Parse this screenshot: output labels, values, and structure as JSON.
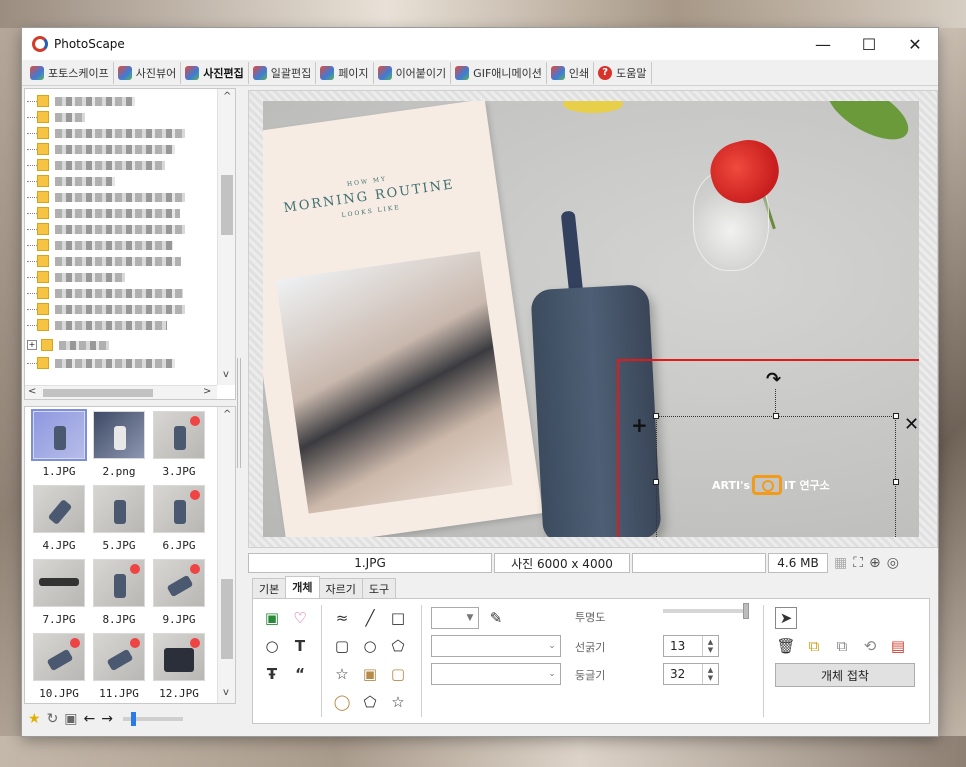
{
  "window": {
    "title": "PhotoScape",
    "controls": [
      "—",
      "☐",
      "✕"
    ]
  },
  "menu_tabs": [
    {
      "label": "포토스케이프",
      "active": false
    },
    {
      "label": "사진뷰어",
      "active": false
    },
    {
      "label": "사진편집",
      "active": true
    },
    {
      "label": "일괄편집",
      "active": false
    },
    {
      "label": "페이지",
      "active": false
    },
    {
      "label": "이어붙이기",
      "active": false
    },
    {
      "label": "GIF애니메이션",
      "active": false
    },
    {
      "label": "인쇄",
      "active": false
    },
    {
      "label": "도움말",
      "active": false
    }
  ],
  "thumbnails": [
    {
      "name": "1.JPG",
      "selected": true
    },
    {
      "name": "2.png",
      "selected": false
    },
    {
      "name": "3.JPG",
      "selected": false
    },
    {
      "name": "4.JPG",
      "selected": false
    },
    {
      "name": "5.JPG",
      "selected": false
    },
    {
      "name": "6.JPG",
      "selected": false
    },
    {
      "name": "7.JPG",
      "selected": false
    },
    {
      "name": "8.JPG",
      "selected": false
    },
    {
      "name": "9.JPG",
      "selected": false
    },
    {
      "name": "10.JPG",
      "selected": false
    },
    {
      "name": "11.JPG",
      "selected": false
    },
    {
      "name": "12.JPG",
      "selected": false
    }
  ],
  "photo": {
    "book_small_top": "HOW MY",
    "book_title": "MORNING ROUTINE",
    "book_small_bottom": "LOOKS LIKE",
    "logo_left": "ARTI's",
    "logo_right": "IT 연구소"
  },
  "status": {
    "filename": "1.JPG",
    "dimensions": "사진 6000 x 4000",
    "extra": "",
    "filesize": "4.6 MB"
  },
  "panel": {
    "tabs": [
      {
        "label": "기본",
        "active": false
      },
      {
        "label": "개체",
        "active": true
      },
      {
        "label": "자르기",
        "active": false
      },
      {
        "label": "도구",
        "active": false
      }
    ],
    "opacity_label": "투명도",
    "line_width_label": "선굵기",
    "line_width_value": "13",
    "roundness_label": "둥글기",
    "roundness_value": "32",
    "attach_button": "개체 접착"
  },
  "colors": {
    "selection_red": "#e01919",
    "accent_blue": "#2a7be4"
  }
}
